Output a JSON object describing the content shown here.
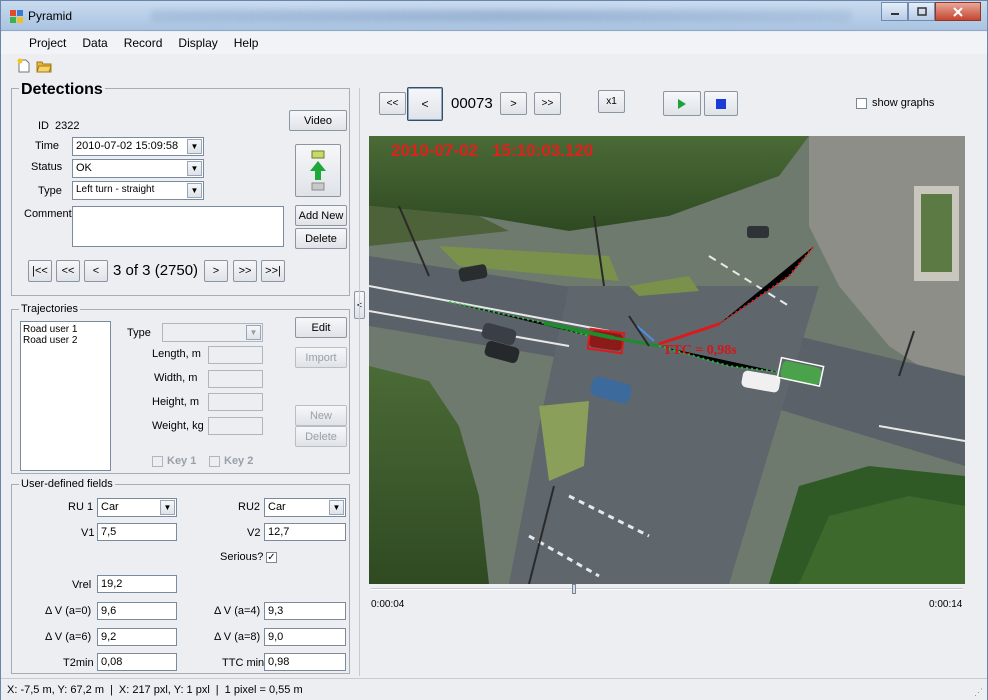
{
  "window": {
    "title": "Pyramid"
  },
  "menu": [
    "Project",
    "Data",
    "Record",
    "Display",
    "Help"
  ],
  "detections": {
    "heading": "Detections",
    "id_label": "ID",
    "id_value": "2322",
    "time_label": "Time",
    "time_value": "2010-07-02  15:09:58",
    "status_label": "Status",
    "status_value": "OK",
    "type_label": "Type",
    "type_value": "Left turn - straight",
    "comment_label": "Comment",
    "comment_value": "",
    "video_btn": "Video",
    "add_new_btn": "Add New",
    "delete_btn": "Delete",
    "nav_first": "|<<",
    "nav_prev_fast": "<<",
    "nav_prev": "<",
    "nav_text": "3 of 3 (2750)",
    "nav_next": ">",
    "nav_next_fast": ">>",
    "nav_last": ">>|"
  },
  "trajectories": {
    "legend": "Trajectories",
    "items": [
      "Road user 1",
      "Road user 2"
    ],
    "type_label": "Type",
    "length_label": "Length, m",
    "width_label": "Width, m",
    "height_label": "Height, m",
    "weight_label": "Weight, kg",
    "edit_btn": "Edit",
    "import_btn": "Import",
    "new_btn": "New",
    "delete_btn": "Delete",
    "key1_label": "Key 1",
    "key2_label": "Key 2"
  },
  "user_fields": {
    "legend": "User-defined fields",
    "ru1_label": "RU 1",
    "ru1_value": "Car",
    "ru2_label": "RU2",
    "ru2_value": "Car",
    "v1_label": "V1",
    "v1_value": "7,5",
    "v2_label": "V2",
    "v2_value": "12,7",
    "serious_label": "Serious?",
    "serious_checked": "✓",
    "vrel_label": "Vrel",
    "vrel_value": "19,2",
    "dv0_label": "Δ V (a=0)",
    "dv0_value": "9,6",
    "dv4_label": "Δ V (a=4)",
    "dv4_value": "9,3",
    "dv6_label": "Δ V (a=6)",
    "dv6_value": "9,2",
    "dv8_label": "Δ V (a=8)",
    "dv8_value": "9,0",
    "t2min_label": "T2min",
    "t2min_value": "0,08",
    "ttcmin_label": "TTC min",
    "ttcmin_value": "0,98"
  },
  "player": {
    "btn_prev_fast": "<<",
    "btn_prev": "<",
    "frame": "00073",
    "btn_next": ">",
    "btn_next_fast": ">>",
    "speed": "x1",
    "show_graphs_label": "show graphs",
    "timestamp": "2010-07-02   15:10:03.120",
    "ttc_label": "TTC = 0,98s",
    "time_start": "0:00:04",
    "time_end": "0:00:14",
    "progress": 0.34
  },
  "collapse_arrow": "<",
  "status": {
    "position_m": "X: -7,5 m, Y: 67,2 m",
    "position_px": "X: 217 pxl, Y: 1 pxl",
    "scale": "1 pixel = 0,55 m"
  },
  "colors": {
    "play": "#1aa33a",
    "stop": "#1c3ad6",
    "timestamp": "#e0201a",
    "ttc": "#d01818"
  }
}
